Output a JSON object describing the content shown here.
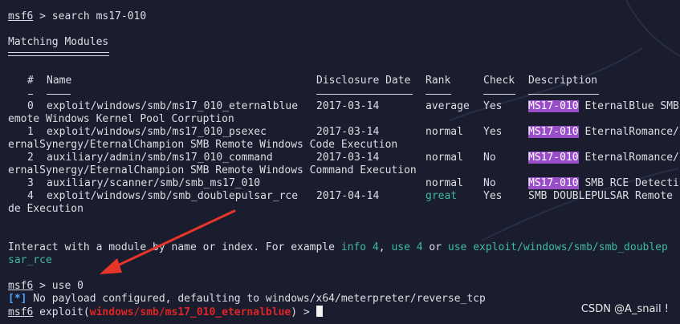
{
  "prompt_1": {
    "user": "msf6",
    "rest": " > search ms17-010"
  },
  "matching_title": "Matching Modules",
  "table": {
    "headers": {
      "num": "#",
      "name": "Name",
      "date": "Disclosure Date",
      "rank": "Rank",
      "check": "Check",
      "desc": "Description"
    },
    "rows": [
      {
        "num": "0",
        "name": "exploit/windows/smb/ms17_010_eternalblue",
        "date": "2017-03-14",
        "rank": "average",
        "check": "Yes",
        "desc_hl": "MS17-010",
        "desc_rest": " EternalBlue SMB",
        "wrap": "emote Windows Kernel Pool Corruption"
      },
      {
        "num": "1",
        "name": "exploit/windows/smb/ms17_010_psexec",
        "date": "2017-03-14",
        "rank": "normal",
        "check": "Yes",
        "desc_hl": "MS17-010",
        "desc_rest": " EternalRomance/",
        "wrap": "ernalSynergy/EternalChampion SMB Remote Windows Code Execution"
      },
      {
        "num": "2",
        "name": "auxiliary/admin/smb/ms17_010_command",
        "date": "2017-03-14",
        "rank": "normal",
        "check": "No",
        "desc_hl": "MS17-010",
        "desc_rest": " EternalRomance/",
        "wrap": "ernalSynergy/EternalChampion SMB Remote Windows Command Execution"
      },
      {
        "num": "3",
        "name": "auxiliary/scanner/smb/smb_ms17_010",
        "date": "",
        "rank": "normal",
        "check": "No",
        "desc_hl": "MS17-010",
        "desc_rest": " SMB RCE Detecti",
        "wrap": ""
      },
      {
        "num": "4",
        "name": "exploit/windows/smb/smb_doublepulsar_rce",
        "date": "2017-04-14",
        "rank": "great",
        "check": "Yes",
        "desc_hl": "",
        "desc_rest": "SMB DOUBLEPULSAR Remote",
        "wrap": "de Execution"
      }
    ]
  },
  "interact": {
    "a": "Interact with a module by name or index. For example ",
    "b": "info 4",
    "c": ", ",
    "d": "use 4",
    "e": " or ",
    "f": "use exploit/windows/smb/smb_doublep",
    "g": "sar_rce"
  },
  "prompt_2": {
    "user": "msf6",
    "rest": " > use 0"
  },
  "info_line": {
    "tag": "[*]",
    "text": " No payload configured, defaulting to windows/x64/meterpreter/reverse_tcp"
  },
  "prompt_3": {
    "user": "msf6",
    "mid": " exploit(",
    "module": "windows/smb/ms17_010_eternalblue",
    "end": ") > "
  },
  "watermark": "CSDN @A_snail !",
  "colors": {
    "background": "#1a1d2e",
    "highlight": "#9b4ec9",
    "green": "#3fb9a3",
    "red": "#e02424",
    "arrow": "#e8352a"
  }
}
